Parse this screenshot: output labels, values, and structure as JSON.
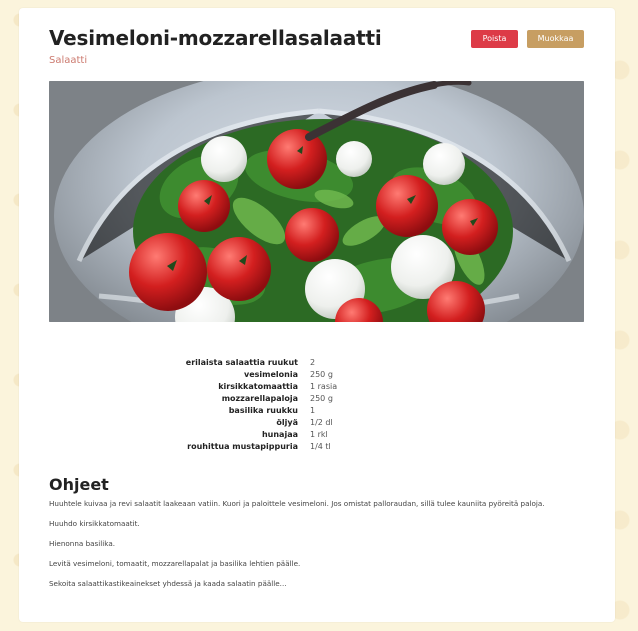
{
  "recipe": {
    "title": "Vesimeloni-mozzarellasalaatti",
    "category": "Salaatti"
  },
  "actions": {
    "delete_label": "Poista",
    "edit_label": "Muokkaa"
  },
  "image": {
    "description": "salad-photo"
  },
  "ingredients": [
    {
      "name": "erilaista salaattia ruukut",
      "amount": "2"
    },
    {
      "name": "vesimelonia",
      "amount": "250 g"
    },
    {
      "name": "kirsikkatomaattia",
      "amount": "1 rasia"
    },
    {
      "name": "mozzarellapaloja",
      "amount": "250 g"
    },
    {
      "name": "basilika ruukku",
      "amount": "1"
    },
    {
      "name": "öljyä",
      "amount": "1/2 dl"
    },
    {
      "name": "hunajaa",
      "amount": "1 rkl"
    },
    {
      "name": "rouhittua mustapippuria",
      "amount": "1/4 tl"
    }
  ],
  "instructions": {
    "title": "Ohjeet",
    "steps": [
      "Huuhtele kuivaa ja revi salaatit laakeaan vatiin. Kuori ja paloittele vesimeloni. Jos omistat palloraudan, sillä tulee kauniita pyöreitä paloja.",
      "Huuhdo kirsikkatomaatit.",
      "Hienonna basilika.",
      "Levitä vesimeloni, tomaatit, mozzarellapalat ja basilika lehtien päälle.",
      "Sekoita salaattikastikeainekset yhdessä ja kaada salaatin päälle..."
    ]
  },
  "colors": {
    "page_background": "#fbf4dc",
    "card": "#ffffff",
    "category": "#cc7a6f",
    "delete": "#dd3b47",
    "edit": "#c79e62"
  }
}
